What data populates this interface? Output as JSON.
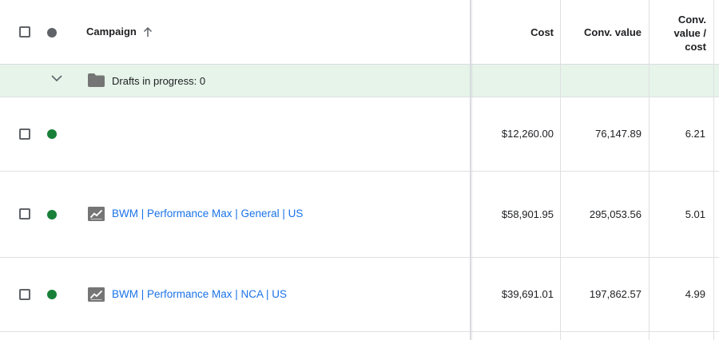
{
  "header": {
    "campaign": "Campaign",
    "cost": "Cost",
    "conv_value": "Conv. value",
    "conv_value_cost_line1": "Conv.",
    "conv_value_cost_line2": "value /",
    "conv_value_cost_line3": "cost"
  },
  "drafts": {
    "label": "Drafts in progress: 0"
  },
  "rows": [
    {
      "name": "",
      "cost": "$12,260.00",
      "conv_value": "76,147.89",
      "ratio": "6.21",
      "status": "enabled"
    },
    {
      "name": "BWM | Performance Max | General | US",
      "cost": "$58,901.95",
      "conv_value": "295,053.56",
      "ratio": "5.01",
      "status": "enabled"
    },
    {
      "name": "BWM | Performance Max | NCA | US",
      "cost": "$39,691.01",
      "conv_value": "197,862.57",
      "ratio": "4.99",
      "status": "enabled"
    }
  ],
  "colors": {
    "link": "#1a73e8",
    "status_enabled": "#188038",
    "drafts_bg": "#e6f4ea"
  },
  "icons": {
    "sort": "arrow-up-icon",
    "expand": "chevron-down-icon",
    "drafts": "folder-icon",
    "campaign_type": "performance-max-icon"
  }
}
